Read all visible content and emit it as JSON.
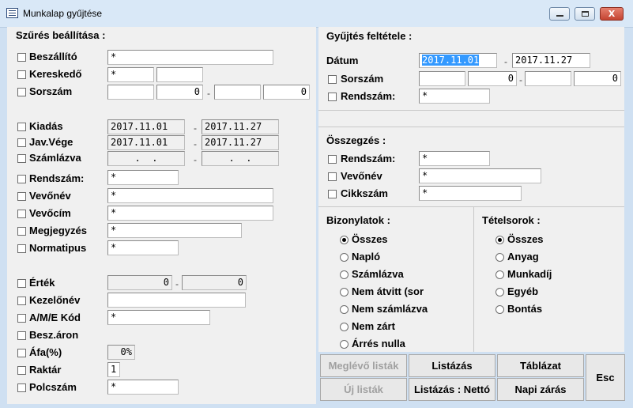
{
  "window": {
    "title": "Munkalap gyűjtése",
    "minimize_label": "",
    "maximize_label": "",
    "close_label": "X"
  },
  "filter": {
    "title": "Szűrés beállítása :",
    "beszallito": {
      "label": "Beszállító",
      "value": "*"
    },
    "keresked": {
      "label": "Kereskedő",
      "value1": "*",
      "value2": ""
    },
    "sorszam": {
      "label": "Sorszám",
      "from_prefix": "",
      "from": "0",
      "to_prefix": "",
      "to": "0"
    },
    "kiadas": {
      "label": "Kiadás",
      "from": "2017.11.01",
      "to": "2017.11.27"
    },
    "javvege": {
      "label": "Jav.Vége",
      "from": "2017.11.01",
      "to": "2017.11.27"
    },
    "szamlazva": {
      "label": "Számlázva",
      "from": "  .  .  ",
      "to": "  .  .  "
    },
    "rendszam": {
      "label": "Rendszám:",
      "value": "*"
    },
    "vevonev": {
      "label": "Vevőnév",
      "value": "*"
    },
    "vevocim": {
      "label": "Vevőcím",
      "value": "*"
    },
    "megjegyzes": {
      "label": "Megjegyzés",
      "value": "*"
    },
    "normatipus": {
      "label": "Normatipus",
      "value": "*"
    },
    "ertek": {
      "label": "Érték",
      "from": "0",
      "to": "0"
    },
    "kezelonev": {
      "label": "Kezelőnév",
      "value": ""
    },
    "amekod": {
      "label": "A/M/E Kód",
      "value": "*"
    },
    "beszaron": {
      "label": "Besz.áron"
    },
    "afa": {
      "label": "Áfa(%)",
      "value": "0%"
    },
    "raktar": {
      "label": "Raktár",
      "value": "1"
    },
    "polcszam": {
      "label": "Polcszám",
      "value": "*"
    },
    "dash": "-"
  },
  "collect": {
    "title": "Gyűjtés feltétele :",
    "datum": {
      "label": "Dátum",
      "from": "2017.11.01",
      "to": "2017.11.27"
    },
    "sorszam": {
      "label": "Sorszám",
      "a": "",
      "b": "0",
      "c": "",
      "d": "0"
    },
    "rendszam": {
      "label": "Rendszám:",
      "value": "*"
    }
  },
  "summary": {
    "title": "Összegzés :",
    "rendszam": {
      "label": "Rendszám:",
      "value": "*"
    },
    "vevonev": {
      "label": "Vevőnév",
      "value": "*"
    },
    "cikkszam": {
      "label": "Cikkszám",
      "value": "*"
    }
  },
  "documents": {
    "title": "Bizonylatok :",
    "options": [
      "Összes",
      "Napló",
      "Számlázva",
      "Nem átvitt (sor",
      "Nem számlázva",
      "Nem zárt",
      "Árrés nulla"
    ],
    "selected": "Összes"
  },
  "items": {
    "title": "Tételsorok :",
    "options": [
      "Összes",
      "Anyag",
      "Munkadíj",
      "Egyéb",
      "Bontás"
    ],
    "selected": "Összes"
  },
  "buttons": {
    "existing_lists": "Meglévő listák",
    "listing": "Listázás",
    "table": "Táblázat",
    "esc": "Esc",
    "new_list": "Új listák",
    "listing_net": "Listázás : Nettó",
    "daily_close": "Napi zárás"
  }
}
